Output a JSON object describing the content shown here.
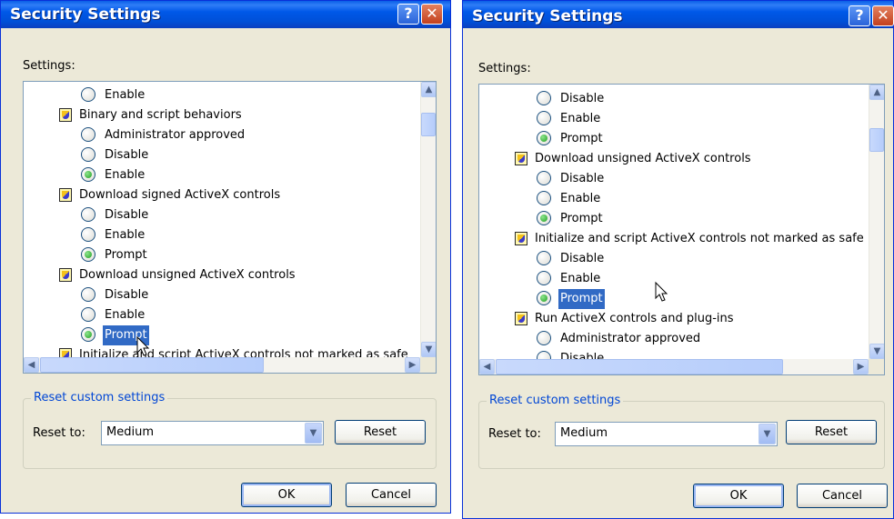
{
  "colors": {
    "titlebar": "#0058e8",
    "selection": "#316ac5",
    "group_legend": "#0046d5",
    "radio_selected": "#21a121",
    "window_face": "#ece9d8"
  },
  "icons": {
    "help": "question-mark",
    "close": "x-close",
    "group": "security-shield",
    "cursor": "arrow-pointer"
  },
  "left": {
    "title": "Security Settings",
    "help_glyph": "?",
    "close_glyph": "✕",
    "settings_label": "Settings:",
    "list": [
      {
        "kind": "option",
        "label": "Enable",
        "selected": false
      },
      {
        "kind": "group",
        "label": "Binary and script behaviors"
      },
      {
        "kind": "option",
        "label": "Administrator approved",
        "selected": false
      },
      {
        "kind": "option",
        "label": "Disable",
        "selected": false
      },
      {
        "kind": "option",
        "label": "Enable",
        "selected": true
      },
      {
        "kind": "group",
        "label": "Download signed ActiveX controls"
      },
      {
        "kind": "option",
        "label": "Disable",
        "selected": false
      },
      {
        "kind": "option",
        "label": "Enable",
        "selected": false
      },
      {
        "kind": "option",
        "label": "Prompt",
        "selected": true
      },
      {
        "kind": "group",
        "label": "Download unsigned ActiveX controls"
      },
      {
        "kind": "option",
        "label": "Disable",
        "selected": false
      },
      {
        "kind": "option",
        "label": "Enable",
        "selected": false
      },
      {
        "kind": "option",
        "label": "Prompt",
        "selected": true,
        "highlighted": true
      },
      {
        "kind": "group",
        "label": "Initialize and script ActiveX controls not marked as safe"
      }
    ],
    "reset_group_title": "Reset custom settings",
    "reset_to_label": "Reset to:",
    "reset_level": "Medium",
    "reset_button": "Reset",
    "ok_button": "OK",
    "cancel_button": "Cancel"
  },
  "right": {
    "title": "Security Settings",
    "help_glyph": "?",
    "close_glyph": "✕",
    "settings_label": "Settings:",
    "list": [
      {
        "kind": "option",
        "label": "Disable",
        "selected": false
      },
      {
        "kind": "option",
        "label": "Enable",
        "selected": false
      },
      {
        "kind": "option",
        "label": "Prompt",
        "selected": true
      },
      {
        "kind": "group",
        "label": "Download unsigned ActiveX controls"
      },
      {
        "kind": "option",
        "label": "Disable",
        "selected": false
      },
      {
        "kind": "option",
        "label": "Enable",
        "selected": false
      },
      {
        "kind": "option",
        "label": "Prompt",
        "selected": true
      },
      {
        "kind": "group",
        "label": "Initialize and script ActiveX controls not marked as safe"
      },
      {
        "kind": "option",
        "label": "Disable",
        "selected": false
      },
      {
        "kind": "option",
        "label": "Enable",
        "selected": false
      },
      {
        "kind": "option",
        "label": "Prompt",
        "selected": true,
        "highlighted": true
      },
      {
        "kind": "group",
        "label": "Run ActiveX controls and plug-ins"
      },
      {
        "kind": "option",
        "label": "Administrator approved",
        "selected": false
      },
      {
        "kind": "option",
        "label": "Disable",
        "selected": false
      }
    ],
    "reset_group_title": "Reset custom settings",
    "reset_to_label": "Reset to:",
    "reset_level": "Medium",
    "reset_button": "Reset",
    "ok_button": "OK",
    "cancel_button": "Cancel"
  }
}
